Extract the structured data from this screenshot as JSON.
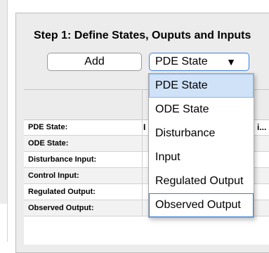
{
  "step": {
    "title": "Step 1: Define States, Ouputs and Inputs"
  },
  "toolbar": {
    "add_label": "Add"
  },
  "select": {
    "value": "PDE State",
    "arrow": "▼"
  },
  "table": {
    "rows": [
      {
        "label": "PDE State:",
        "partial_left": "I",
        "partial_right": "i..."
      },
      {
        "label": "ODE State:"
      },
      {
        "label": "Disturbance Input:"
      },
      {
        "label": "Control Input:"
      },
      {
        "label": "Regulated Output:"
      },
      {
        "label": "Observed Output:"
      }
    ]
  },
  "dropdown": {
    "options": [
      "PDE State",
      "ODE State",
      "Disturbance",
      "Input",
      "Regulated Output",
      "Observed Output"
    ],
    "selected": "PDE State",
    "focused": "Observed Output"
  },
  "colors": {
    "accent": "#3b80d6",
    "selected_bg": "#cfe2f8",
    "panel_bg": "#ececec"
  }
}
